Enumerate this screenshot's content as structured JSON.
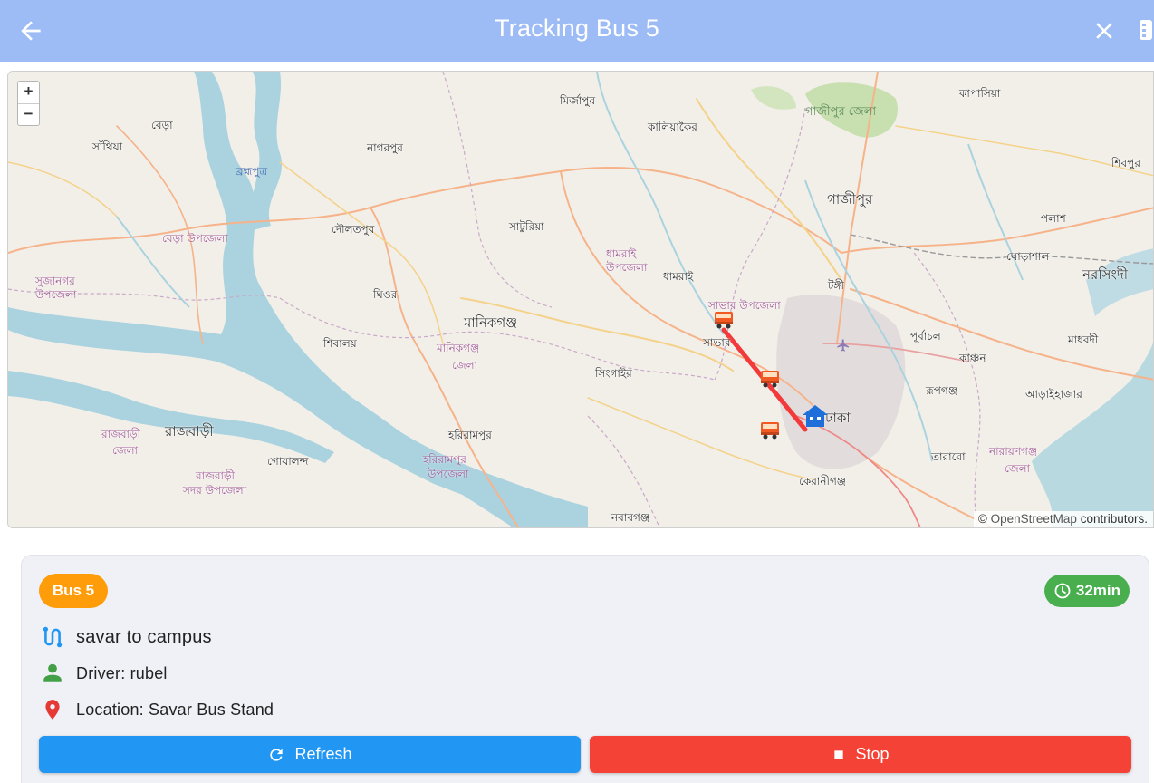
{
  "appbar": {
    "title": "Tracking Bus 5",
    "back_icon": "arrow-left-icon",
    "close_icon": "close-icon",
    "more_icon": "more-icon"
  },
  "map": {
    "zoom_in": "+",
    "zoom_out": "−",
    "attribution_prefix": "©",
    "attribution_link": "OpenStreetMap",
    "attribution_suffix": "contributors.",
    "labels": {
      "mirzapur": "মির্জাপুর",
      "kaliakair": "কালিয়াকৈর",
      "gazipur_zila": "গাজীপুর জেলা",
      "kapasia": "কাপাসিয়া",
      "bera": "বেড়া",
      "santhia": "সাঁথিয়া",
      "nagarpur": "নাগরপুর",
      "brahmaputra": "ব্রহ্মপুত্র",
      "shibpur": "শিবপুর",
      "gazipur": "গাজীপুর",
      "palash": "পলাশ",
      "saturia": "সাটুরিয়া",
      "daulatpur": "দৌলতপুর",
      "bera_upazila": "বেড়া উপজেলা",
      "dhamrai_upazila_1": "ধামরাই",
      "dhamrai_upazila_2": "উপজেলা",
      "ghorashal": "ঘোড়াশাল",
      "narsingdi": "নরসিংদী",
      "sujanagar_1": "সুজানগর",
      "sujanagar_2": "উপজেলা",
      "dhamrai": "ধামরাই",
      "tongi": "টঙ্গী",
      "ghior": "ঘিওর",
      "savar_upazila": "সাভার উপজেলা",
      "manikganj": "মানিকগঞ্জ",
      "savar": "সাভার",
      "purbachal": "পূর্বাচল",
      "madhabdi": "মাধবদী",
      "shibalaya": "শিবালয়",
      "manikganj_zila_1": "মানিকগঞ্জ",
      "manikganj_zila_2": "জেলা",
      "kachon": "কাঞ্চন",
      "singair": "সিংগাইর",
      "rupganj": "রূপগঞ্জ",
      "araihazar": "আড়াইহাজার",
      "dhaka": "ঢাকা",
      "rajbari_zila_1": "রাজবাড়ী",
      "rajbari_zila_2": "জেলা",
      "rajbari": "রাজবাড়ী",
      "harirampur": "হরিরামপুর",
      "narayanganj_zila_1": "নারায়ণগঞ্জ",
      "narayanganj_zila_2": "জেলা",
      "goalanda": "গোয়ালন্দ",
      "tarabo": "তারাবো",
      "harirampur_upazila_1": "হরিরামপুর",
      "harirampur_upazila_2": "উপজেলা",
      "rajbari_sadar_1": "রাজবাড়ী",
      "rajbari_sadar_2": "সদর উপজেলা",
      "keraniganj": "কেরানীগঞ্জ",
      "nawabganj": "নবাবগঞ্জ"
    },
    "colors": {
      "route": "#f23a3a",
      "water": "#aad3df",
      "land": "#f2efe9"
    }
  },
  "card": {
    "bus_badge": "Bus 5",
    "eta": "32min",
    "route": "savar to campus",
    "driver": "Driver: rubel",
    "location": "Location: Savar Bus Stand",
    "refresh_label": "Refresh",
    "stop_label": "Stop",
    "colors": {
      "bus_badge": "#ff9c0a",
      "eta_badge": "#48ae4e",
      "refresh": "#2196f3",
      "stop": "#f44336"
    }
  }
}
